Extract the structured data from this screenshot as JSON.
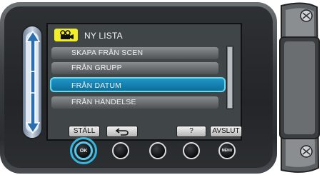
{
  "menu": {
    "title": "NY LISTA",
    "items": [
      {
        "label": "SKAPA FRÅN SCEN"
      },
      {
        "label": "FRÅN GRUPP"
      },
      {
        "label": "FRÅN DATUM"
      },
      {
        "label": "FRÅN HÄNDELSE"
      }
    ],
    "selected_index": 2
  },
  "buttons": {
    "stall": "STÄLL",
    "help": "?",
    "avslut": "AVSLUT",
    "ok": "OK",
    "menu": "MENU"
  },
  "icons": [
    "video-camera-icon",
    "back-arrow-icon",
    "up-arrow-icon",
    "down-arrow-icon"
  ],
  "colors": {
    "selection": "#1f95c7",
    "title_icon_bg": "#f1ee2a",
    "highlight_ring": "#33b7e0"
  }
}
